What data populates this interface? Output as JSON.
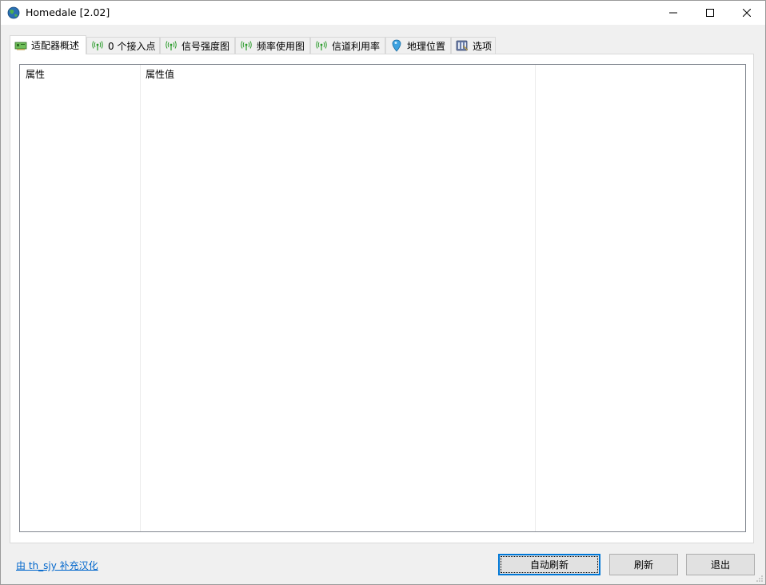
{
  "window": {
    "title": "Homedale [2.02]"
  },
  "tabs": [
    {
      "label": "适配器概述",
      "icon": "network-card-icon",
      "active": true
    },
    {
      "label": "0 个接入点",
      "icon": "wifi-antenna-icon",
      "active": false
    },
    {
      "label": "信号强度图",
      "icon": "wifi-antenna-icon",
      "active": false
    },
    {
      "label": "频率使用图",
      "icon": "wifi-antenna-icon",
      "active": false
    },
    {
      "label": "信道利用率",
      "icon": "wifi-antenna-icon",
      "active": false
    },
    {
      "label": "地理位置",
      "icon": "map-pin-icon",
      "active": false
    },
    {
      "label": "选项",
      "icon": "options-icon",
      "active": false
    }
  ],
  "list": {
    "columns": [
      "属性",
      "属性值",
      ""
    ]
  },
  "footer": {
    "credit_link": "由 th_sjy 补充汉化",
    "auto_refresh_label": "自动刷新",
    "refresh_label": "刷新",
    "exit_label": "退出"
  },
  "colors": {
    "accent": "#0078d7",
    "link": "#0066cc",
    "antenna_green": "#2c9c2c"
  }
}
